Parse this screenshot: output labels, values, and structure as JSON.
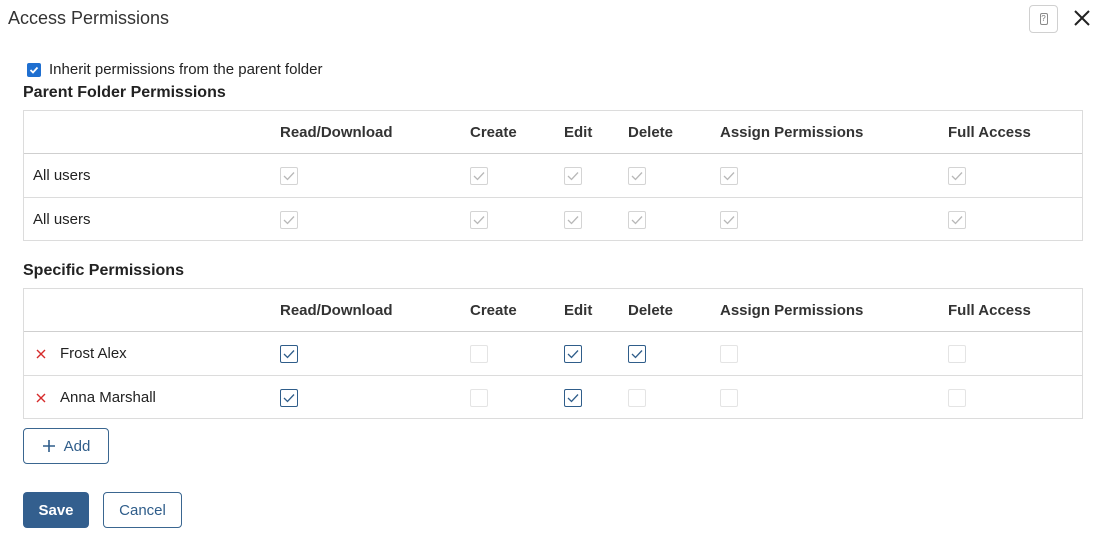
{
  "dialog": {
    "title": "Access Permissions",
    "help_icon": "help-icon",
    "close_icon": "close-icon"
  },
  "inherit": {
    "label": "Inherit permissions from the parent folder",
    "checked": true,
    "accent": "#1f6fd0"
  },
  "columns": [
    "Read/Download",
    "Create",
    "Edit",
    "Delete",
    "Assign Permissions",
    "Full Access"
  ],
  "parent": {
    "title": "Parent Folder Permissions",
    "rows": [
      {
        "name": "All users",
        "perms": [
          true,
          true,
          true,
          true,
          true,
          true
        ]
      },
      {
        "name": "All users",
        "perms": [
          true,
          true,
          true,
          true,
          true,
          true
        ]
      }
    ]
  },
  "specific": {
    "title": "Specific Permissions",
    "rows": [
      {
        "name": "Frost Alex",
        "perms": [
          true,
          false,
          true,
          true,
          false,
          false
        ]
      },
      {
        "name": "Anna Marshall",
        "perms": [
          true,
          false,
          true,
          false,
          false,
          false
        ]
      }
    ]
  },
  "actions": {
    "add_label": "Add",
    "save_label": "Save",
    "cancel_label": "Cancel"
  },
  "colors": {
    "primary": "#335f8e",
    "remove": "#d62b2b",
    "check_active": "#2f5d8a",
    "check_disabled": "#b8b8b8"
  }
}
